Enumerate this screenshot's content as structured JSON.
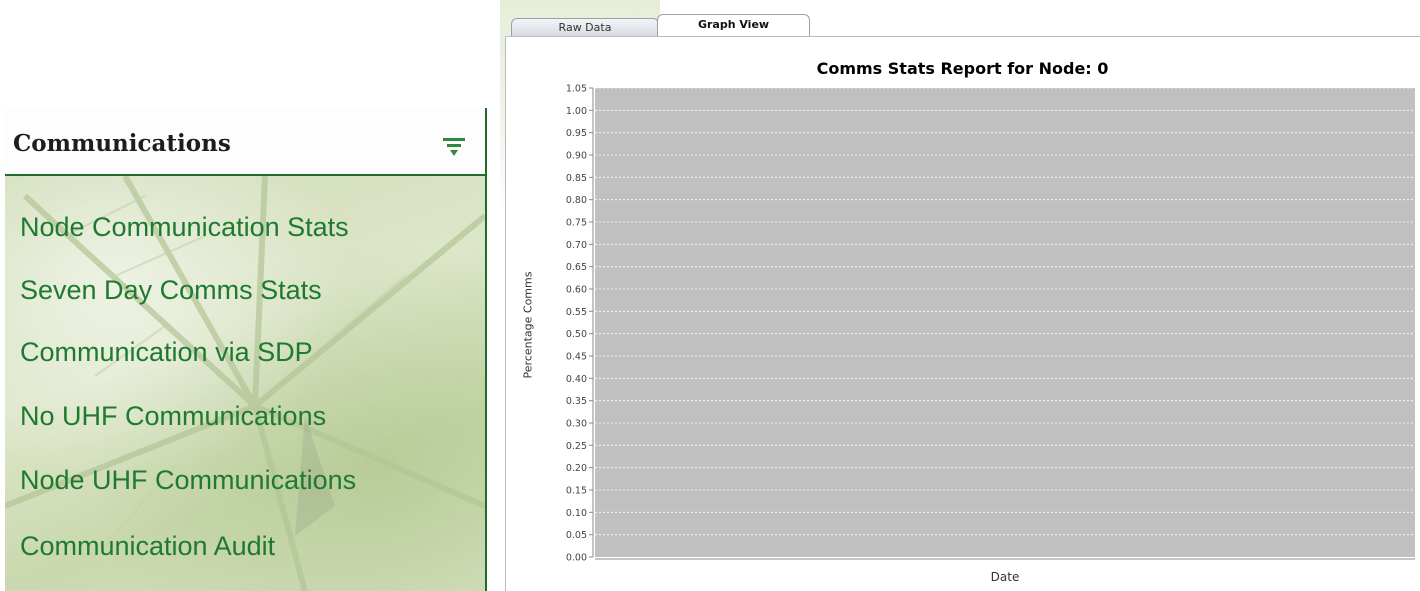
{
  "sidebar": {
    "title": "Communications",
    "filter_icon": "filter-icon",
    "items": [
      {
        "label": "Node Communication Stats"
      },
      {
        "label": "Seven Day Comms Stats"
      },
      {
        "label": "Communication via SDP"
      },
      {
        "label": "No UHF Communications"
      },
      {
        "label": "Node UHF Communications"
      },
      {
        "label": "Communication Audit"
      }
    ]
  },
  "tabs": [
    {
      "label": "Raw Data",
      "selected": false
    },
    {
      "label": "Graph View",
      "selected": true
    }
  ],
  "colors": {
    "accent_green": "#1e7a30",
    "plot_background": "#c0c0c0",
    "gridline": "#ffffff"
  },
  "chart_data": {
    "type": "line",
    "title": "Comms Stats Report for Node: 0",
    "xlabel": "Date",
    "ylabel": "Percentage Comms",
    "ylim": [
      0,
      1.05
    ],
    "yticks": [
      "0.00",
      "0.05",
      "0.10",
      "0.15",
      "0.20",
      "0.25",
      "0.30",
      "0.35",
      "0.40",
      "0.45",
      "0.50",
      "0.55",
      "0.60",
      "0.65",
      "0.70",
      "0.75",
      "0.80",
      "0.85",
      "0.90",
      "0.95",
      "1.00",
      "1.05"
    ],
    "series": [],
    "grid": true
  }
}
